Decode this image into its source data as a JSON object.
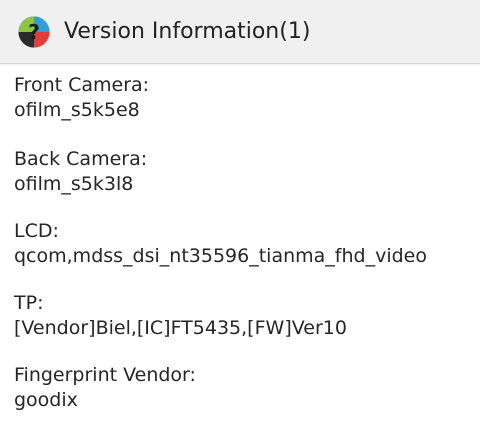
{
  "header": {
    "title": "Version Information(1)",
    "icon": "question-mark-icon"
  },
  "info": [
    {
      "label": "Front Camera:",
      "value": "ofilm_s5k5e8"
    },
    {
      "label": "Back  Camera:",
      "value": "ofilm_s5k3l8"
    },
    {
      "label": "LCD:",
      "value": "qcom,mdss_dsi_nt35596_tianma_fhd_video"
    },
    {
      "label": "TP:",
      "value": "[Vendor]Biel,[IC]FT5435,[FW]Ver10"
    },
    {
      "label": "Fingerprint Vendor:",
      "value": "goodix"
    }
  ],
  "colors": {
    "header_background": "#f0f0f0",
    "text": "#262626"
  }
}
